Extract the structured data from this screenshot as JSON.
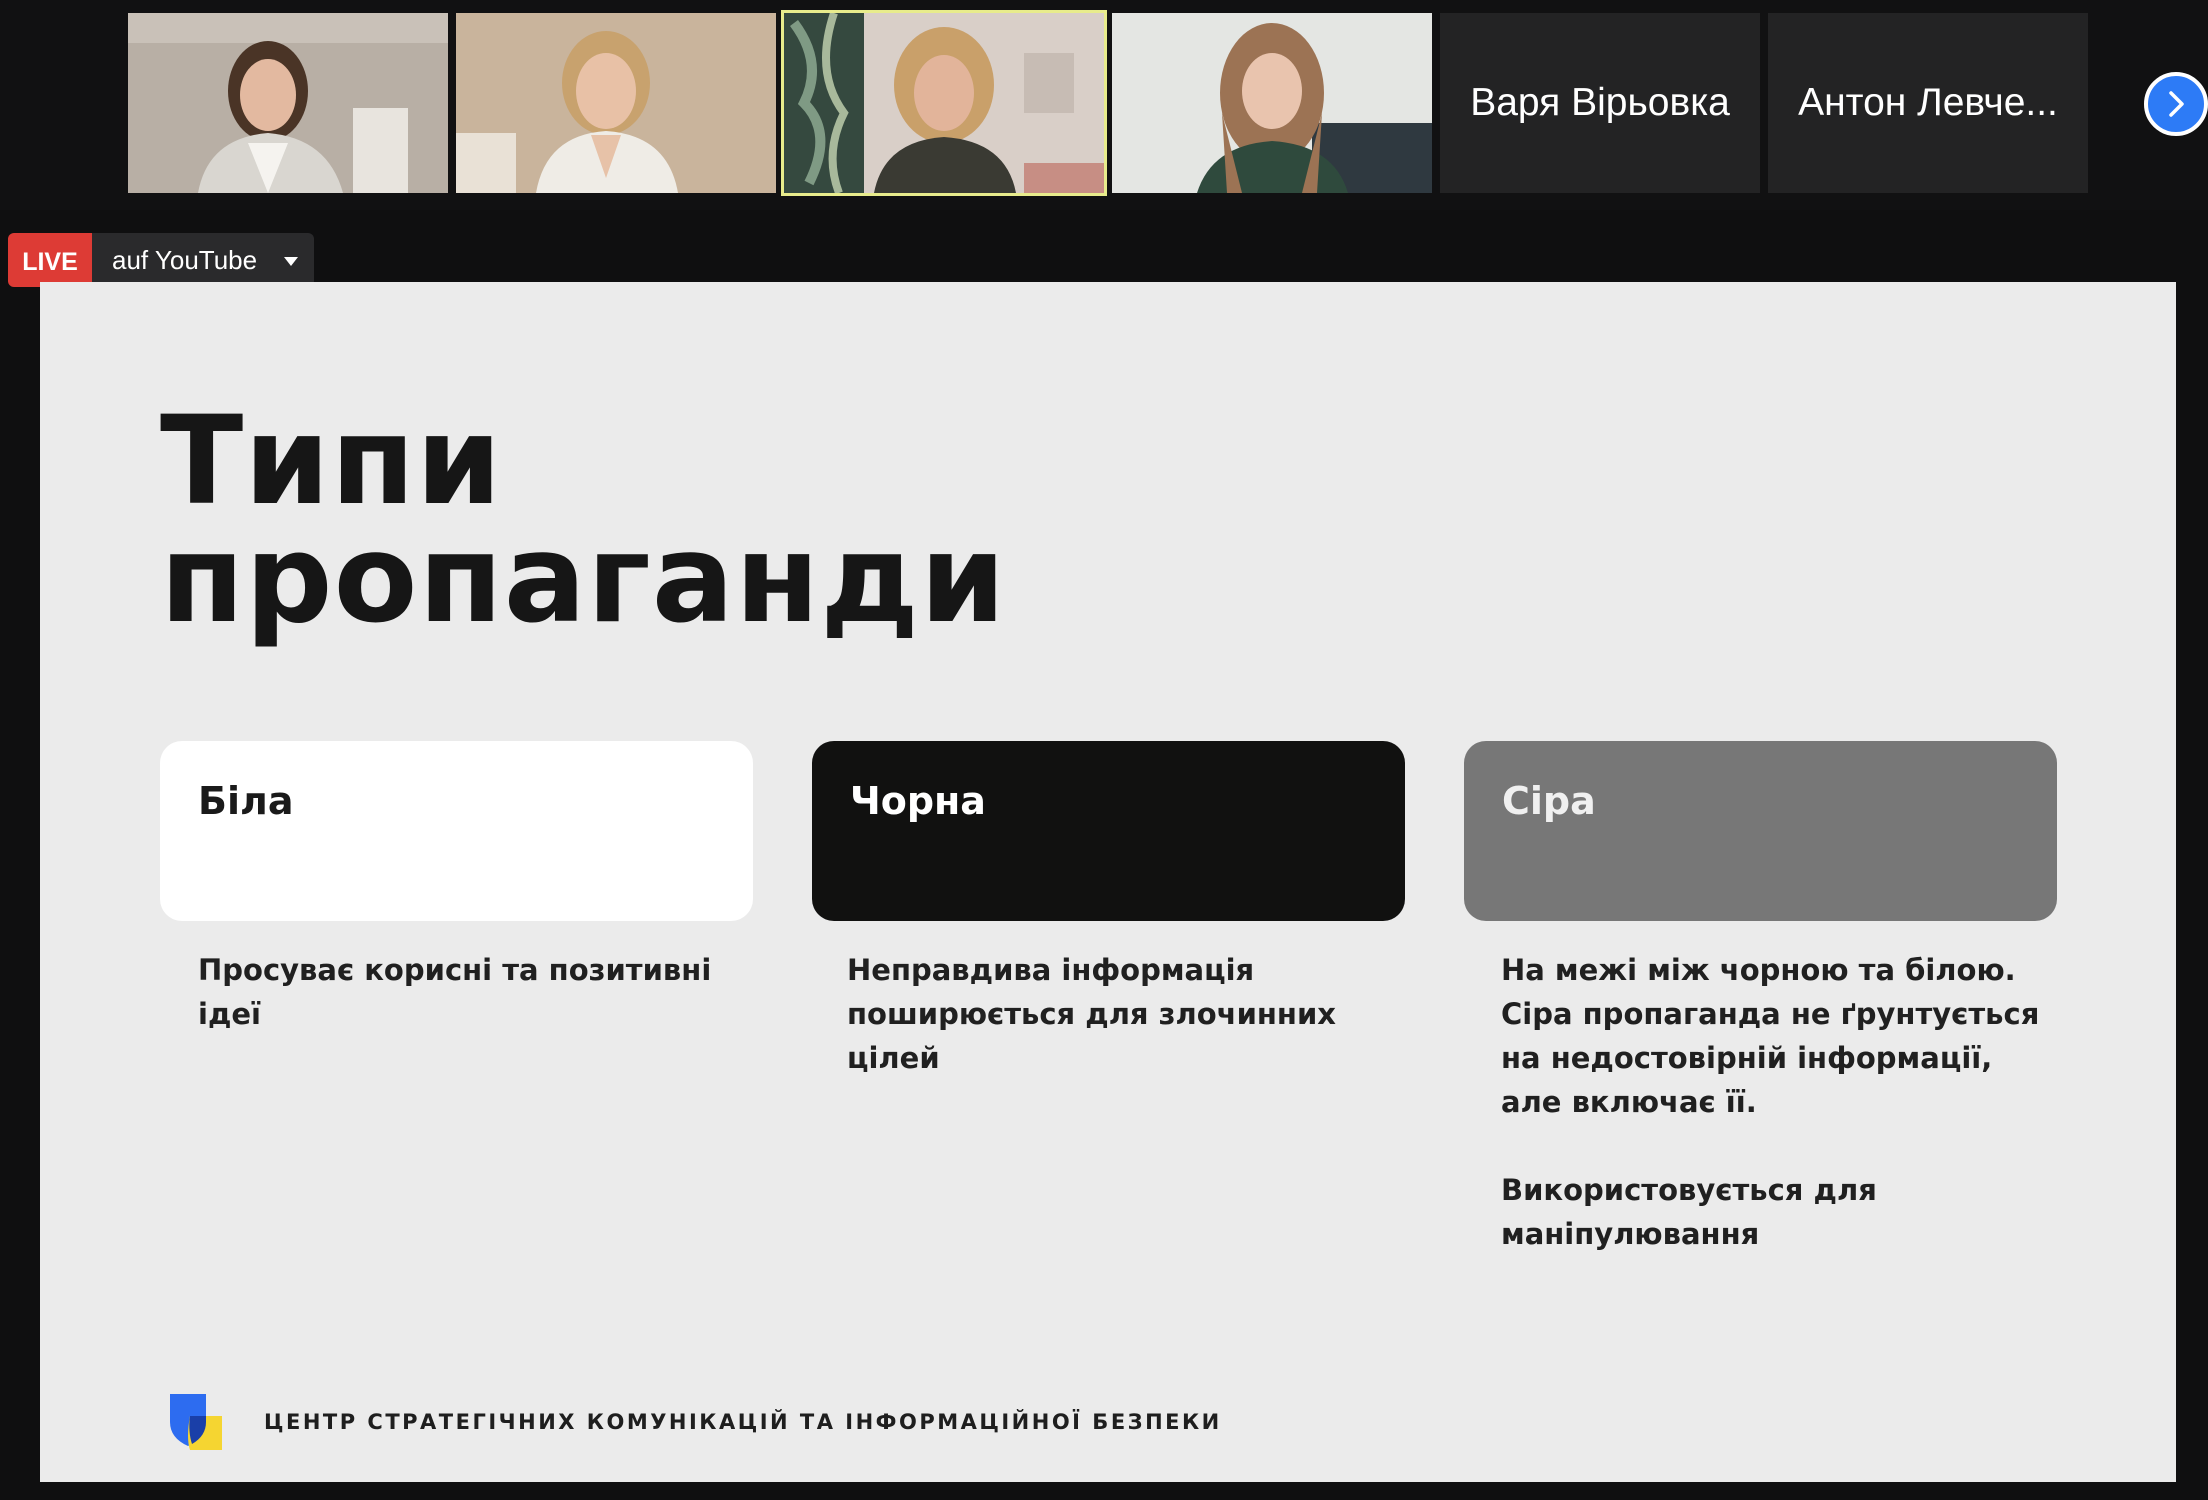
{
  "participants": [
    {
      "type": "video",
      "active": false
    },
    {
      "type": "video",
      "active": false
    },
    {
      "type": "video",
      "active": true
    },
    {
      "type": "video",
      "active": false
    },
    {
      "type": "name",
      "name": "Варя Вірьовка"
    },
    {
      "type": "name",
      "name": "Антон Левче..."
    }
  ],
  "next_button_icon": "chevron-right-icon",
  "live": {
    "badge": "LIVE",
    "destination": "auf YouTube"
  },
  "slide": {
    "title_line1": "Типи",
    "title_line2": "пропаганди",
    "cards": [
      {
        "label": "Біла",
        "description": [
          "Просуває корисні та позитивні ідеї"
        ]
      },
      {
        "label": "Чорна",
        "description": [
          "Неправдива інформація поширюється для  злочинних цілей"
        ]
      },
      {
        "label": "Сіра",
        "description": [
          "На межі між чорною та білою. Сіра пропаганда не ґрунтується на недостовірній інформації, але включає її.",
          "Використовується для маніпулювання"
        ]
      }
    ],
    "footer": "ЦЕНТР СТРАТЕГІЧНИХ КОМУНІКАЦІЙ ТА ІНФОРМАЦІЙНОЇ БЕЗПЕКИ"
  },
  "colors": {
    "live_red": "#dd3b35",
    "active_speaker_border": "#e8ec8c",
    "next_button_blue": "#2d7bf6",
    "logo_blue": "#2d6cf0",
    "logo_yellow": "#f5d531"
  }
}
